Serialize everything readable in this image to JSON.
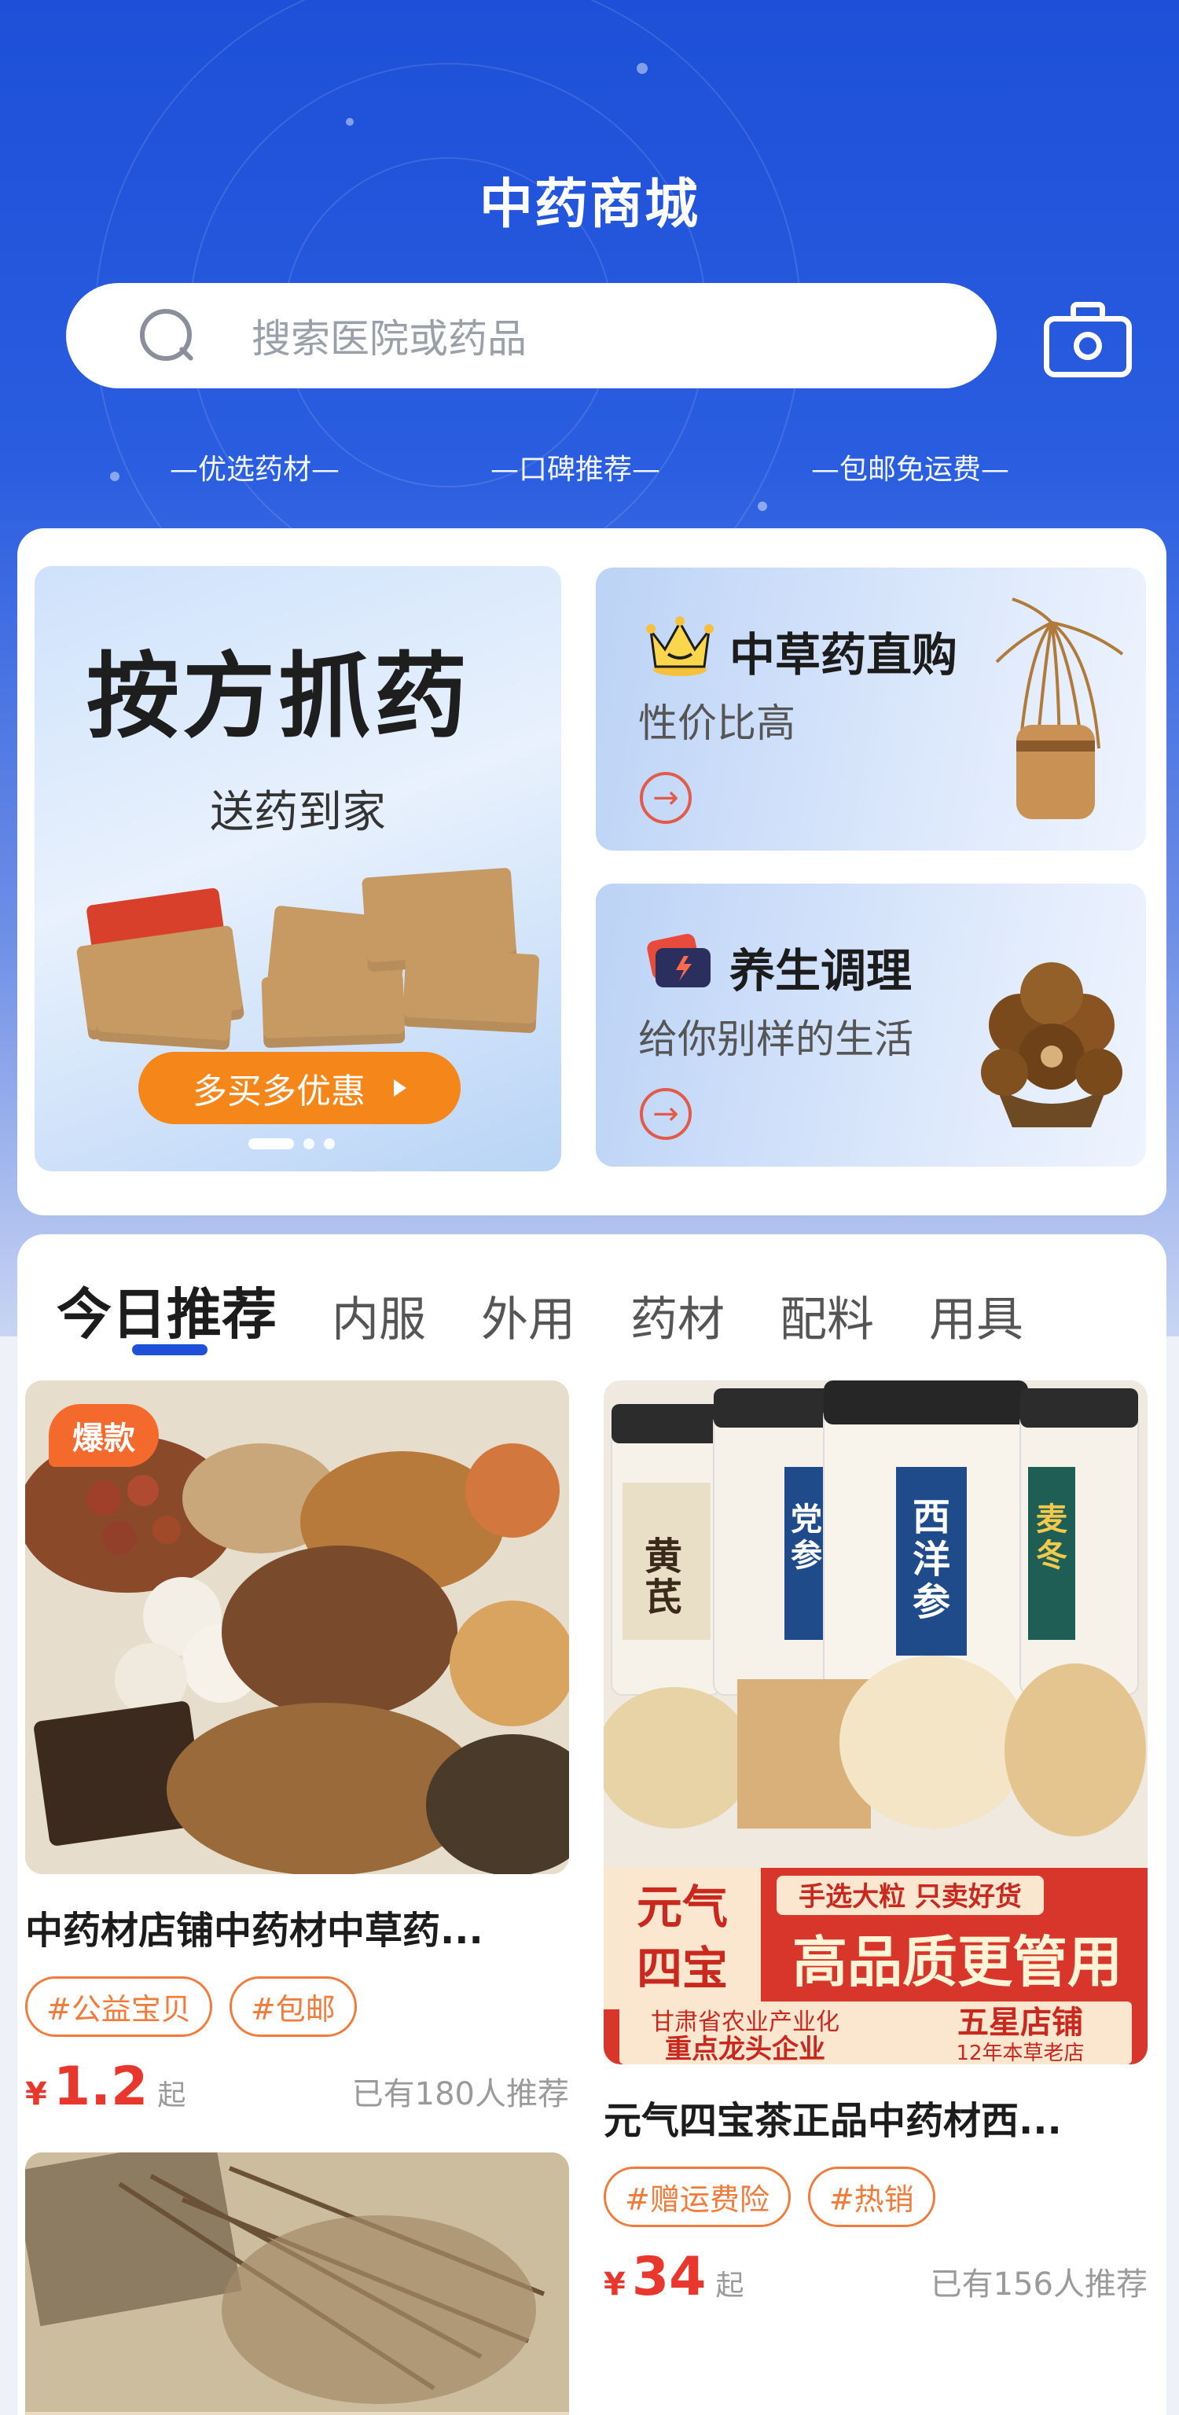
{
  "header": {
    "title": "中药商城",
    "search_placeholder": "搜索医院或药品",
    "features": [
      "—优选药材—",
      "—口碑推荐—",
      "—包邮免运费—"
    ]
  },
  "promo": {
    "main": {
      "title": "按方抓药",
      "subtitle": "送药到家",
      "button": "多买多优惠"
    },
    "cards": [
      {
        "title": "中草药直购",
        "subtitle": "性价比高",
        "icon": "crown-icon"
      },
      {
        "title": "养生调理",
        "subtitle": "给你别样的生活",
        "icon": "wallet-icon"
      }
    ]
  },
  "tabs": [
    "今日推荐",
    "内服",
    "外用",
    "药材",
    "配料",
    "用具"
  ],
  "products": [
    {
      "badge": "爆款",
      "title": "中药材店铺中药材中草药...",
      "tags": [
        "#公益宝贝",
        "#包邮"
      ],
      "currency": "¥",
      "price": "1.2",
      "price_unit": "起",
      "recommend": "已有180人推荐"
    },
    {
      "title": "元气四宝茶正品中药材西...",
      "tags": [
        "#赠运费险",
        "#热销"
      ],
      "currency": "¥",
      "price": "34",
      "price_unit": "起",
      "recommend": "已有156人推荐",
      "image_text": {
        "jars": [
          "黄芪",
          "党参",
          "西洋参",
          "麦冬"
        ],
        "brand": "元气\n四宝",
        "banner_top": "手选大粒 只卖好货",
        "banner_main": "高品质更管用",
        "footer_left_1": "甘肃省农业产业化",
        "footer_left_2": "重点龙头企业",
        "footer_right_1": "五星店铺",
        "footer_right_2": "12年本草老店"
      }
    }
  ],
  "colors": {
    "brand_blue": "#1d4fd8",
    "accent_orange": "#f5861a",
    "price_red": "#e8372c",
    "tag_orange": "#f07b3a"
  }
}
